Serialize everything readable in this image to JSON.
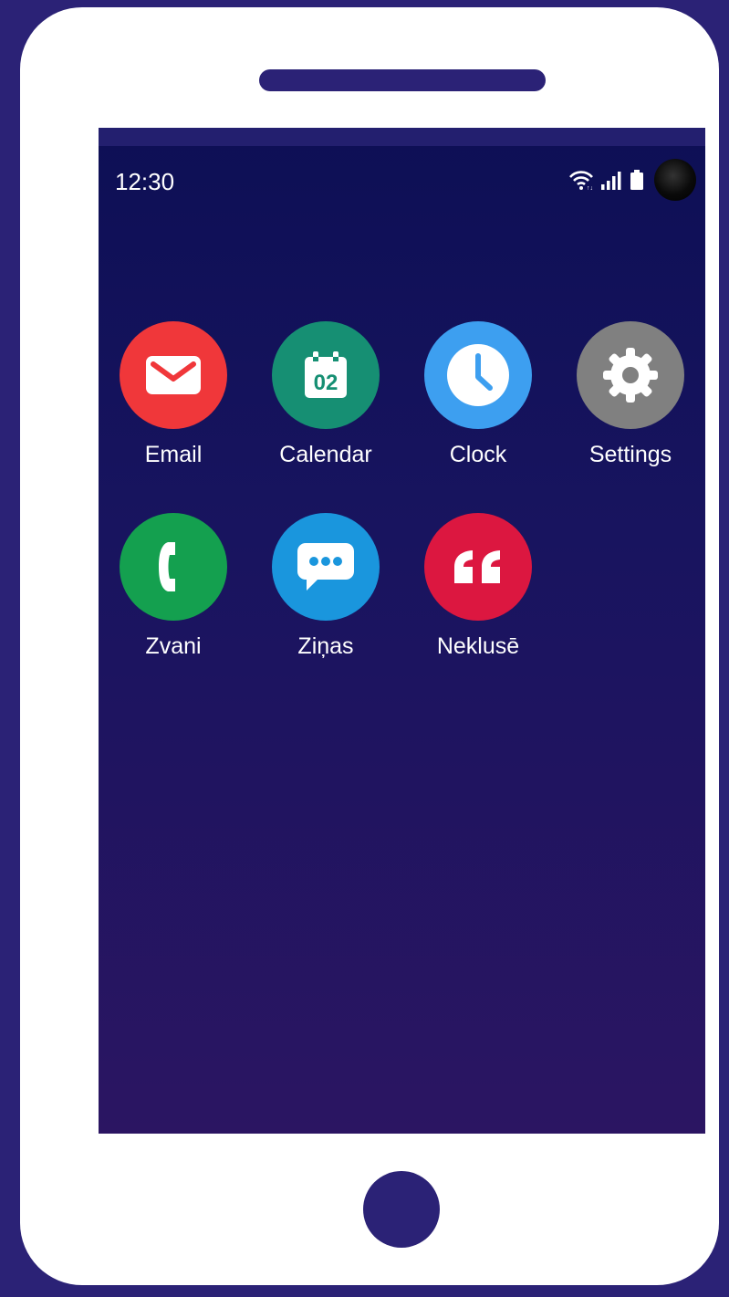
{
  "status_bar": {
    "time": "12:30",
    "icons": [
      "wifi-icon",
      "signal-icon",
      "battery-icon",
      "camera-icon"
    ]
  },
  "apps": [
    {
      "label": "Email",
      "icon": "envelope-icon",
      "color": "#f0373a"
    },
    {
      "label": "Calendar",
      "icon": "calendar-icon",
      "color": "#168f73",
      "icon_text": "02"
    },
    {
      "label": "Clock",
      "icon": "clock-icon",
      "color": "#3d9ff0"
    },
    {
      "label": "Settings",
      "icon": "gear-icon",
      "color": "#808080"
    },
    {
      "label": "Zvani",
      "icon": "phone-icon",
      "color": "#14a04f"
    },
    {
      "label": "Ziņas",
      "icon": "chat-bubble-icon",
      "color": "#1a96dd"
    },
    {
      "label": "Neklusē",
      "icon": "quote-icon",
      "color": "#dc1740"
    }
  ],
  "colors": {
    "background": "#2b2276",
    "phone_body": "#ffffff",
    "screen_top": "#0d0f55",
    "screen_bottom": "#2b1562"
  }
}
